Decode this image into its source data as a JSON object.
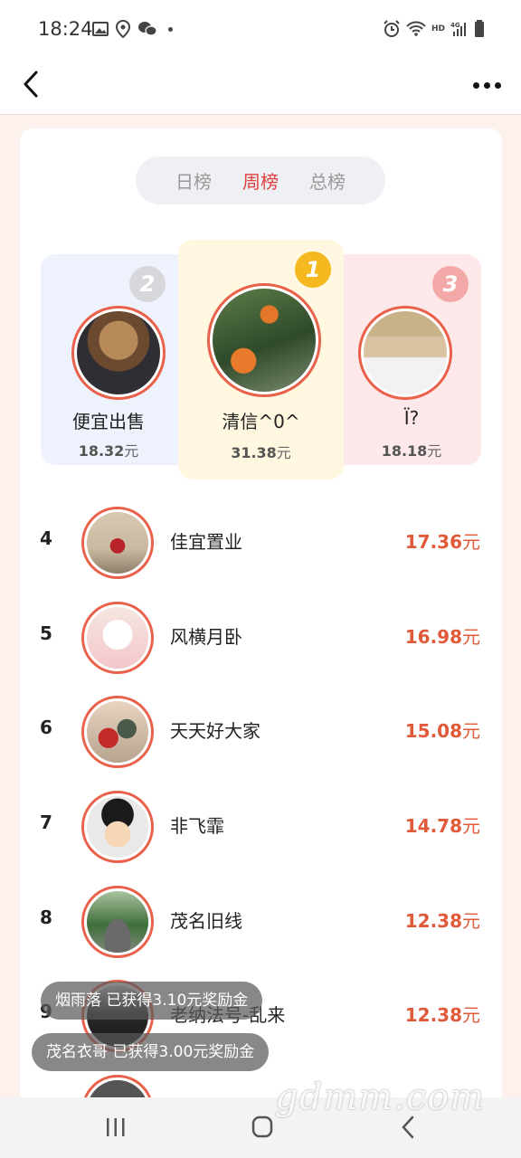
{
  "status_bar": {
    "time": "18:24"
  },
  "tabs": [
    {
      "label": "日榜",
      "active": false
    },
    {
      "label": "周榜",
      "active": true
    },
    {
      "label": "总榜",
      "active": false
    }
  ],
  "podium": [
    {
      "rank": "2",
      "name": "便宜出售",
      "amount": "18.32",
      "unit": "元"
    },
    {
      "rank": "1",
      "name": "清信^0^",
      "amount": "31.38",
      "unit": "元"
    },
    {
      "rank": "3",
      "name": "Ï?",
      "amount": "18.18",
      "unit": "元"
    }
  ],
  "rankings": [
    {
      "rank": "4",
      "name": "佳宜置业",
      "amount": "17.36",
      "unit": "元"
    },
    {
      "rank": "5",
      "name": "风横月卧",
      "amount": "16.98",
      "unit": "元"
    },
    {
      "rank": "6",
      "name": "天天好大家",
      "amount": "15.08",
      "unit": "元"
    },
    {
      "rank": "7",
      "name": "非飞霏",
      "amount": "14.78",
      "unit": "元"
    },
    {
      "rank": "8",
      "name": "茂名旧线",
      "amount": "12.38",
      "unit": "元"
    },
    {
      "rank": "9",
      "name": "老纳法号-乱来",
      "amount": "12.38",
      "unit": "元"
    }
  ],
  "toasts": [
    "烟雨落 已获得3.10元奖励金",
    "茂名衣哥 已获得3.00元奖励金"
  ],
  "watermark": "gdmm.com",
  "colors": {
    "accent": "#e0403f",
    "amount": "#e05a3a",
    "gold": "#f5b81e"
  }
}
